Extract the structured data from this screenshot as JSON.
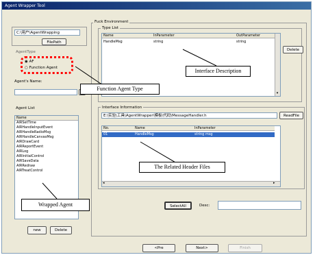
{
  "window": {
    "title": "Agent Wrapper Tool"
  },
  "left": {
    "file_input_value": "C:\\用户\\AgentWrapping",
    "file_path_button": "FilePath",
    "agent_type": {
      "group_label": "AgentType",
      "options": [
        "AF",
        "Function Agent"
      ],
      "selected_index": 0
    },
    "agent_name_label": "Agent's Name:",
    "agent_name_value": "",
    "agent_list_label": "Agent List",
    "agent_list_header": "Name",
    "agent_list_items": [
      "AIRSetTime",
      "AIRHandleInputEvent",
      "AIRHandleRadioMsg",
      "AIRHandleCanvasMsg",
      "AIRDrawCard",
      "AIRReportEvent",
      "AIRLog",
      "AIRInitialControl",
      "AIRSaveData",
      "AIRRedraw",
      "AIRTreatControl"
    ],
    "new_button": "new",
    "delete_button": "Delete"
  },
  "right": {
    "group_label": "Fuck Environment",
    "type_list_label": "Type List",
    "type_table": {
      "columns": [
        "Name",
        "InParameter",
        "OutParameter"
      ],
      "rows": [
        [
          "HandleMsg",
          "string",
          "string"
        ]
      ]
    },
    "type_delete_button": "Delete",
    "interface_label": "Interface Information",
    "header_path_value": "E:\\实验\\工具\\AgentWrapper\\模板\\代码\\MessageHandler.h",
    "read_file_button": "ReadFile",
    "interface_table": {
      "columns": [
        "No.",
        "Name",
        "InParameter"
      ],
      "rows": [
        [
          "01",
          "HandleMsg",
          "string msg"
        ]
      ],
      "selected_index": 0
    },
    "select_button": "SelectAll",
    "desc_label": "Desc:",
    "desc_value": ""
  },
  "nav": {
    "prev": "<Pre",
    "next": "Next>",
    "finish": "Finish"
  },
  "callouts": {
    "interface_description": "Interface Description",
    "function_agent_type": "Function Agent Type",
    "related_header_files": "The Related Header Files",
    "wrapped_agent": "Wrapped Agent"
  },
  "colors": {
    "highlight": "#ff0000",
    "selection": "#316ac5",
    "title_bar": "#0a246a"
  }
}
